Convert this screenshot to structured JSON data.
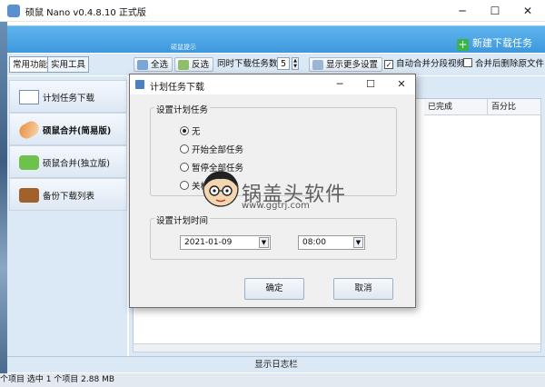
{
  "window": {
    "title": "硕鼠 Nano v0.4.8.10 正式版",
    "controls": {
      "minimize": "─",
      "maximize": "☐",
      "close": "✕"
    }
  },
  "banner": {
    "text": "硕鼠提示",
    "new_task": "新建下载任务"
  },
  "tabs": [
    "常用功能",
    "实用工具"
  ],
  "toolbar": {
    "select_all": "全选",
    "invert": "反选",
    "concurrent_label": "同时下载任务数:",
    "concurrent_value": "5",
    "more_settings": "显示更多设置",
    "auto_merge": "自动合并分段视频",
    "auto_merge_checked": true,
    "delete_after": "合并后删除原文件",
    "delete_after_checked": false
  },
  "sidebar": {
    "items": [
      {
        "label": "计划任务下载"
      },
      {
        "label": "硕鼠合并(简易版)"
      },
      {
        "label": "硕鼠合并(独立版)"
      },
      {
        "label": "备份下载列表"
      }
    ]
  },
  "table": {
    "columns": [
      "已完成",
      "百分比"
    ]
  },
  "log_bar": "显示日志栏",
  "status": "个项目    选中 1 个项目  2.88 MB",
  "dialog": {
    "title": "计划任务下载",
    "group_task": "设置计划任务",
    "options": [
      "无",
      "开始全部任务",
      "暂停全部任务",
      "关机"
    ],
    "selected_option": 0,
    "group_time": "设置计划时间",
    "date": "2021-01-09",
    "time": "08:00",
    "ok": "确定",
    "cancel": "取消"
  },
  "watermark": {
    "title": "锅盖头软件",
    "url": "www.ggtrj.com"
  },
  "colors": {
    "banner": "#3d98dc",
    "panel": "#dbe8f5",
    "new_task_icon": "#3cb24a"
  }
}
